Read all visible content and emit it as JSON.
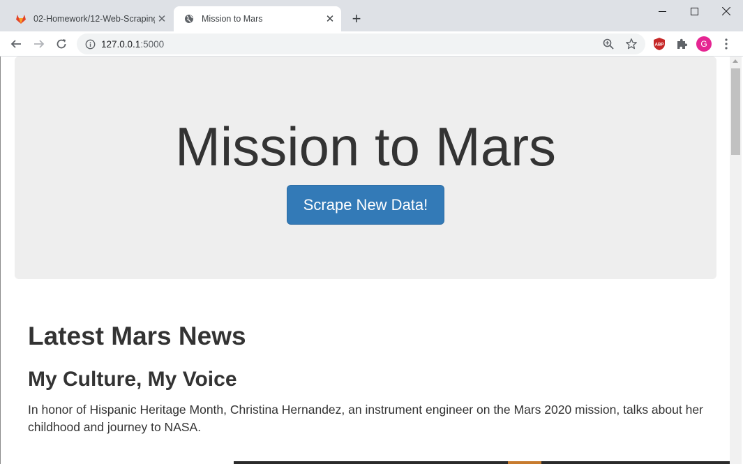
{
  "browser": {
    "tabs": [
      {
        "title": "02-Homework/12-Web-Scraping",
        "active": false,
        "favicon": "gitlab-icon"
      },
      {
        "title": "Mission to Mars",
        "active": true,
        "favicon": "globe-icon"
      }
    ],
    "url": {
      "host": "127.0.0.1",
      "port": ":5000"
    },
    "avatar_letter": "G",
    "accent": "#e52592"
  },
  "page": {
    "title": "Mission to Mars",
    "scrape_button": "Scrape New Data!",
    "news_section_heading": "Latest Mars News",
    "news_title": "My Culture, My Voice",
    "news_paragraph": "In honor of Hispanic Heritage Month, Christina Hernandez, an instrument engineer on the Mars 2020 mission, talks about her childhood and journey to NASA.",
    "button_color": "#337ab7",
    "jumbotron_color": "#eeeeee"
  }
}
